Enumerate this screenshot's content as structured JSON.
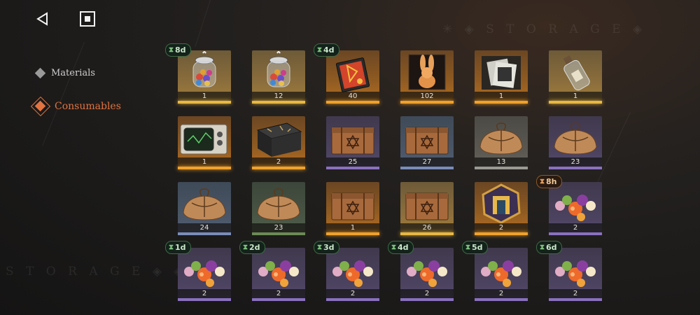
{
  "nav": {
    "back_icon": "back-triangle-icon",
    "home_icon": "square-stop-icon"
  },
  "watermarks": {
    "top": "✳ ◈ S T O R A G E ◈",
    "bottom": "S T O R A G E  ◈ ◈"
  },
  "sidebar": {
    "items": [
      {
        "label": "Materials",
        "active": false
      },
      {
        "label": "Consumables",
        "active": true
      }
    ]
  },
  "grid": {
    "items": [
      {
        "kind": "jar",
        "qty": "1",
        "rarity": "gold",
        "timer": "8d"
      },
      {
        "kind": "jar",
        "qty": "12",
        "rarity": "gold",
        "timer": ""
      },
      {
        "kind": "book",
        "qty": "40",
        "rarity": "orange",
        "timer": "4d"
      },
      {
        "kind": "rabbit",
        "qty": "102",
        "rarity": "orange",
        "timer": ""
      },
      {
        "kind": "photos",
        "qty": "1",
        "rarity": "orange",
        "timer": ""
      },
      {
        "kind": "bottle",
        "qty": "1",
        "rarity": "gold",
        "timer": ""
      },
      {
        "kind": "tv",
        "qty": "1",
        "rarity": "orange",
        "timer": ""
      },
      {
        "kind": "chest",
        "qty": "2",
        "rarity": "orange",
        "timer": ""
      },
      {
        "kind": "crate",
        "qty": "25",
        "rarity": "purple",
        "timer": ""
      },
      {
        "kind": "crate",
        "qty": "27",
        "rarity": "blue",
        "timer": ""
      },
      {
        "kind": "sack",
        "qty": "13",
        "rarity": "white",
        "timer": ""
      },
      {
        "kind": "sack",
        "qty": "23",
        "rarity": "purple",
        "timer": ""
      },
      {
        "kind": "sack",
        "qty": "24",
        "rarity": "blue",
        "timer": ""
      },
      {
        "kind": "sack",
        "qty": "23",
        "rarity": "green",
        "timer": ""
      },
      {
        "kind": "crate",
        "qty": "1",
        "rarity": "orange",
        "timer": ""
      },
      {
        "kind": "crate",
        "qty": "26",
        "rarity": "gold",
        "timer": ""
      },
      {
        "kind": "medallion",
        "qty": "2",
        "rarity": "orange",
        "timer": ""
      },
      {
        "kind": "candy",
        "qty": "2",
        "rarity": "purple",
        "timer": "8h"
      },
      {
        "kind": "candy",
        "qty": "2",
        "rarity": "purple",
        "timer": "1d"
      },
      {
        "kind": "candy",
        "qty": "2",
        "rarity": "purple",
        "timer": "2d"
      },
      {
        "kind": "candy",
        "qty": "2",
        "rarity": "purple",
        "timer": "3d"
      },
      {
        "kind": "candy",
        "qty": "2",
        "rarity": "purple",
        "timer": "4d"
      },
      {
        "kind": "candy",
        "qty": "2",
        "rarity": "purple",
        "timer": "5d"
      },
      {
        "kind": "candy",
        "qty": "2",
        "rarity": "purple",
        "timer": "6d"
      }
    ]
  },
  "colors": {
    "accent": "#e3733f",
    "timer_green": "#3d6a44"
  }
}
